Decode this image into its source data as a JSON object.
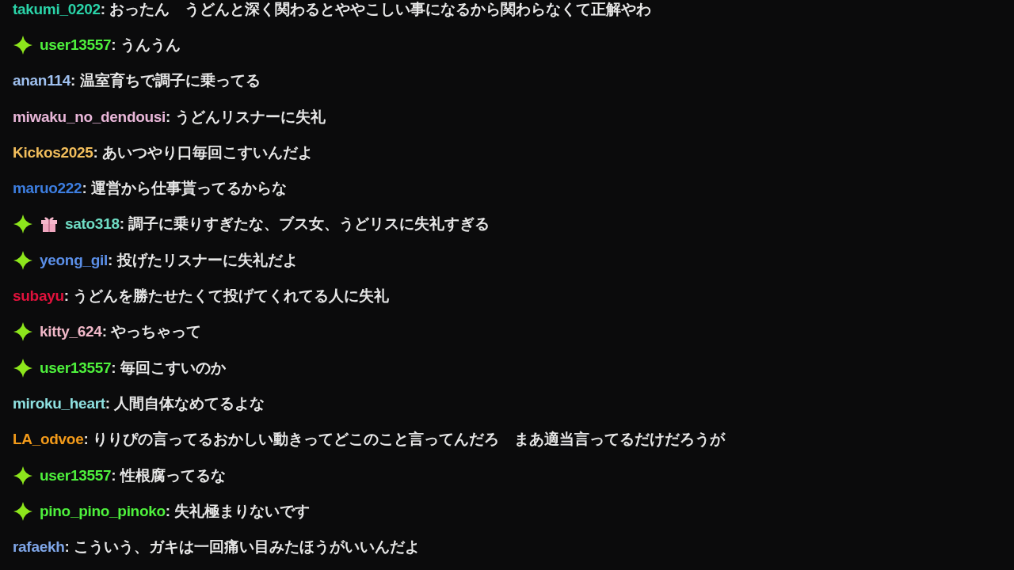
{
  "messages": [
    {
      "user": "takumi_0202",
      "color": "#2ad3a8",
      "vip": false,
      "gift": false,
      "text": ": おったん　うどんと深く関わるとややこしい事になるから関わらなくて正解やわ"
    },
    {
      "user": "user13557",
      "color": "#4ef03c",
      "vip": true,
      "gift": false,
      "text": ": うんうん"
    },
    {
      "user": "anan114",
      "color": "#9fc0ef",
      "vip": false,
      "gift": false,
      "text": ": 温室育ちで調子に乗ってる"
    },
    {
      "user": "miwaku_no_dendousi",
      "color": "#e8b6d8",
      "vip": false,
      "gift": false,
      "text": ": うどんリスナーに失礼"
    },
    {
      "user": "Kickos2025",
      "color": "#f2be5c",
      "vip": false,
      "gift": false,
      "text": ": あいつやり口毎回こすいんだよ"
    },
    {
      "user": "maruo222",
      "color": "#3d7ee0",
      "vip": false,
      "gift": false,
      "text": ": 運営から仕事貰ってるからな"
    },
    {
      "user": "sato318",
      "color": "#6fdcc4",
      "vip": true,
      "gift": true,
      "text": ": 調子に乗りすぎたな、ブス女、うどリスに失礼すぎる"
    },
    {
      "user": "yeong_gil",
      "color": "#5b8fe8",
      "vip": true,
      "gift": false,
      "text": ": 投げたリスナーに失礼だよ"
    },
    {
      "user": "subayu",
      "color": "#e0123c",
      "vip": false,
      "gift": false,
      "text": ": うどんを勝たせたくて投げてくれてる人に失礼"
    },
    {
      "user": "kitty_624",
      "color": "#f0b8c8",
      "vip": true,
      "gift": false,
      "text": ": やっちゃって"
    },
    {
      "user": "user13557",
      "color": "#4ef03c",
      "vip": true,
      "gift": false,
      "text": ": 毎回こすいのか"
    },
    {
      "user": "miroku_heart",
      "color": "#8ee0e0",
      "vip": false,
      "gift": false,
      "text": ": 人間自体なめてるよな"
    },
    {
      "user": "LA_odvoe",
      "color": "#f29a1a",
      "vip": false,
      "gift": false,
      "text": ": りりぴの言ってるおかしい動きってどこのこと言ってんだろ　まあ適当言ってるだけだろうが"
    },
    {
      "user": "user13557",
      "color": "#4ef03c",
      "vip": true,
      "gift": false,
      "text": ": 性根腐ってるな"
    },
    {
      "user": "pino_pino_pinoko",
      "color": "#4ef03c",
      "vip": true,
      "gift": false,
      "text": ": 失礼極まりないです"
    },
    {
      "user": "rafaekh",
      "color": "#7fa6e8",
      "vip": false,
      "gift": false,
      "text": ": こういう、ガキは一回痛い目みたほうがいいんだよ"
    }
  ]
}
